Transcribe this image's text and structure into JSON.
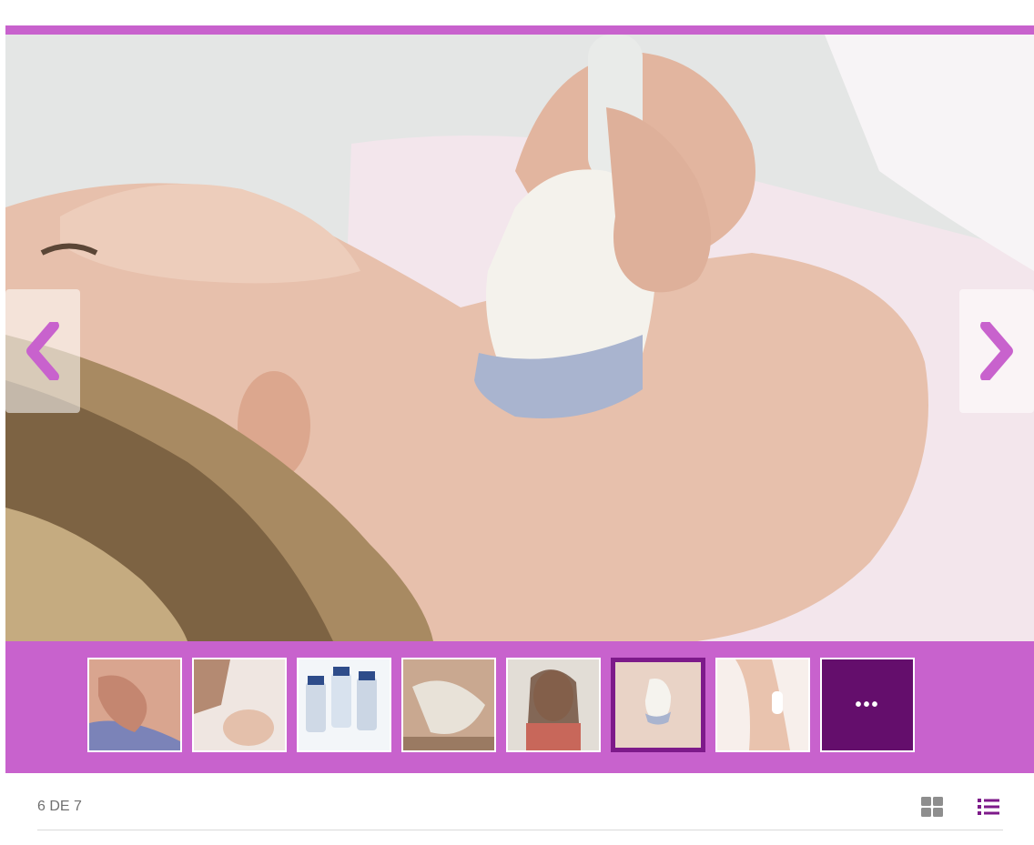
{
  "gallery": {
    "accent_color": "#c862cd",
    "active_border_color": "#7d1a8a",
    "more_tile_color": "#640e6c",
    "main_image": {
      "icon": "ultrasound-neck-photo"
    },
    "nav": {
      "prev_icon": "chevron-left-icon",
      "next_icon": "chevron-right-icon"
    },
    "thumbnails": [
      {
        "icon": "thumbnail-hands-on-neck"
      },
      {
        "icon": "thumbnail-facial-treatment"
      },
      {
        "icon": "thumbnail-vials"
      },
      {
        "icon": "thumbnail-face-mask"
      },
      {
        "icon": "thumbnail-woman-smiling"
      },
      {
        "icon": "thumbnail-ultrasound-neck",
        "active": true
      },
      {
        "icon": "thumbnail-neck-hand"
      }
    ],
    "more_label": "•••",
    "counter": "6 DE 7",
    "views": {
      "grid_icon": "grid-view-icon",
      "list_icon": "list-view-icon"
    }
  }
}
